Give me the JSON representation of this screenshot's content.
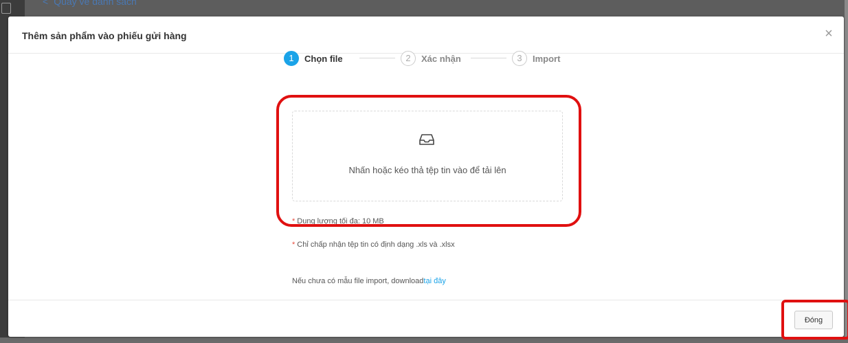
{
  "background": {
    "back_link": "Quay về danh sách"
  },
  "modal": {
    "title": "Thêm sản phẩm vào phiếu gửi hàng",
    "close_symbol": "×",
    "steps": [
      {
        "number": "1",
        "label": "Chọn file",
        "state": "active"
      },
      {
        "number": "2",
        "label": "Xác nhận",
        "state": "idle"
      },
      {
        "number": "3",
        "label": "Import",
        "state": "idle"
      }
    ],
    "upload": {
      "icon": "inbox-icon",
      "text": "Nhấn hoặc kéo thả tệp tin vào để tải lên"
    },
    "notes": {
      "asterisk": "*",
      "max_size": "Dung lượng tối đa: 10 MB",
      "formats": "Chỉ chấp nhận tệp tin có định dạng .xls và .xlsx",
      "template_prefix": "Nếu chưa có mẫu file import, download",
      "template_link": "tại đây"
    },
    "footer": {
      "close_label": "Đóng"
    }
  },
  "colors": {
    "accent": "#1aa3e8",
    "required": "#e84c3d",
    "highlight": "#e01010"
  }
}
